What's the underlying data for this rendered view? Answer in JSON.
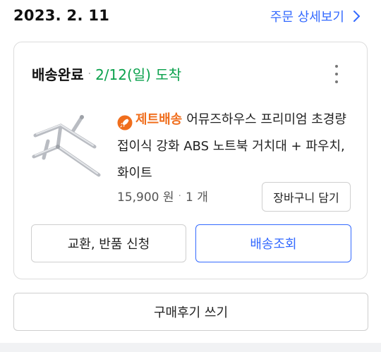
{
  "order": {
    "date": "2023. 2. 11",
    "detail_link": "주문 상세보기"
  },
  "shipment": {
    "status": "배송완료",
    "separator": "·",
    "arrival": "2/12(일) 도착"
  },
  "product": {
    "badge": "제트배송",
    "name": "어뮤즈하우스 프리미엄 초경량 접이식 강화 ABS 노트북 거치대 + 파우치, 화이트",
    "price": "15,900 원",
    "qty_separator": "·",
    "quantity": "1 개"
  },
  "buttons": {
    "add_to_cart": "장바구니 담기",
    "exchange_return": "교환, 반품 신청",
    "track_delivery": "배송조회",
    "write_review": "구매후기 쓰기"
  },
  "colors": {
    "accent": "#346aff",
    "arrival": "#0aa14c",
    "rocket": "#f06e1d"
  },
  "icons": {
    "detail_chevron": "chevron-right-icon",
    "more": "kebab-menu-icon",
    "badge": "rocket-icon"
  }
}
